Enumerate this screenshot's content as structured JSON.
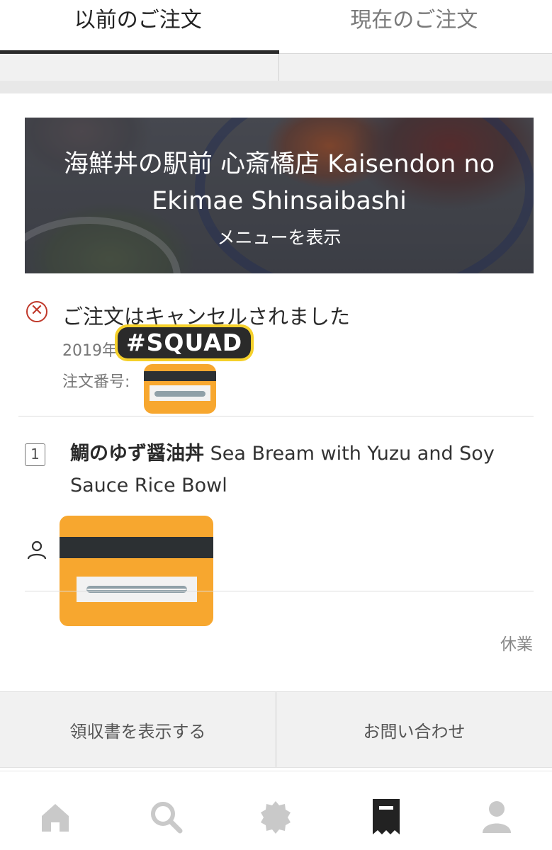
{
  "tabs": {
    "past_orders": "以前のご注文",
    "current_orders": "現在のご注文"
  },
  "restaurant": {
    "name": "海鮮丼の駅前 心斎橋店 Kaisendon no Ekimae Shinsaibashi",
    "view_menu": "メニューを表示"
  },
  "order": {
    "status": "ご注文はキャンセルされました",
    "date_prefix": "2019年",
    "order_number_label": "注文番号:",
    "sticker_text": "#SQUAD",
    "item": {
      "quantity": "1",
      "name_jp": "鯛のゆず醤油丼",
      "name_en": "Sea Bream with Yuzu and Soy Sauce Rice Bowl"
    },
    "closed_label": "休業"
  },
  "actions": {
    "receipt": "領収書を表示する",
    "contact": "お問い合わせ"
  },
  "nav": {
    "items": [
      {
        "icon": "home-icon"
      },
      {
        "icon": "search-icon"
      },
      {
        "icon": "badge-icon"
      },
      {
        "icon": "receipt-icon"
      },
      {
        "icon": "account-icon"
      }
    ]
  },
  "colors": {
    "cancel_red": "#c0392b",
    "sticker_orange": "#f7a72f",
    "nav_inactive": "#c9c9c9",
    "nav_active": "#222222"
  }
}
